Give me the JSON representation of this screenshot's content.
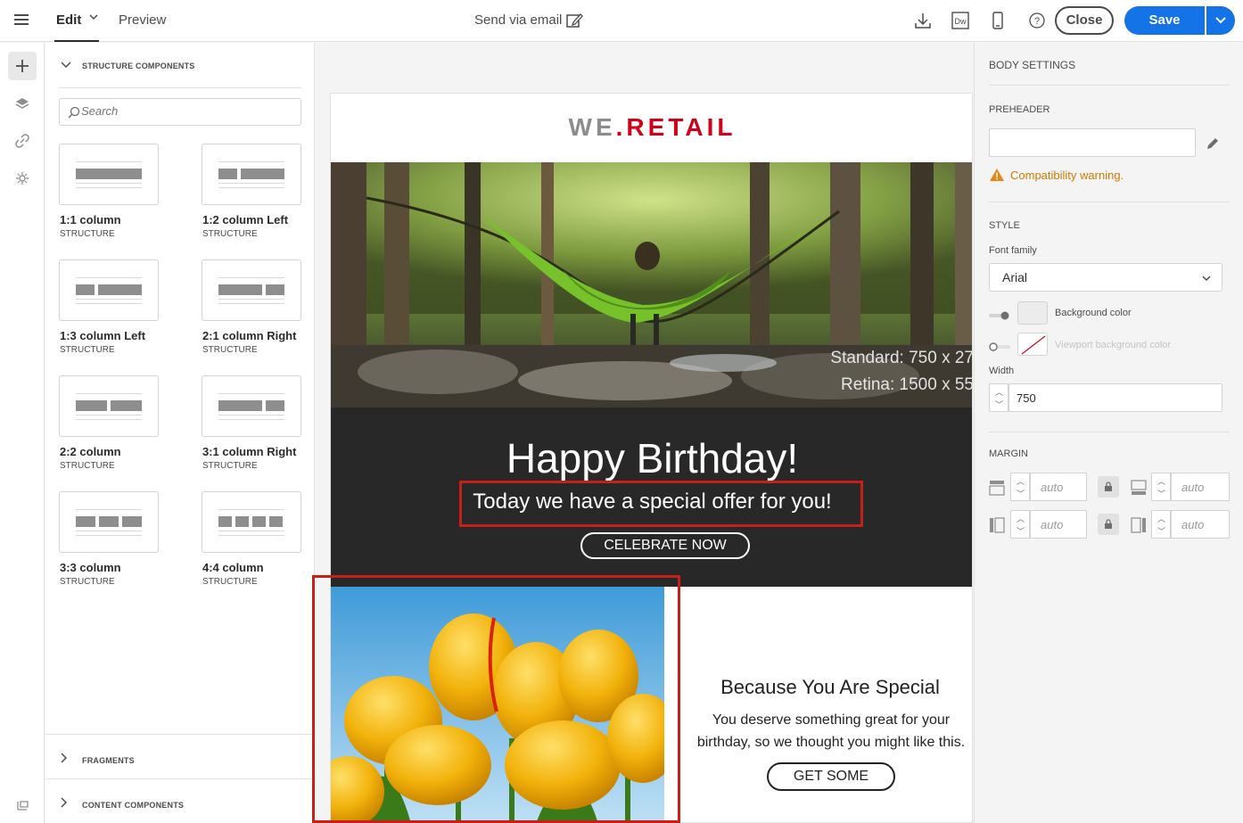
{
  "topbar": {
    "tab_edit": "Edit",
    "tab_preview": "Preview",
    "send_via_email": "Send via email",
    "close_label": "Close",
    "save_label": "Save",
    "dw_label": "Dw"
  },
  "panel": {
    "structure_heading": "STRUCTURE COMPONENTS",
    "search_placeholder": "Search",
    "components": [
      {
        "name": "1:1 column",
        "type": "STRUCTURE"
      },
      {
        "name": "1:2 column Left",
        "type": "STRUCTURE"
      },
      {
        "name": "1:3 column Left",
        "type": "STRUCTURE"
      },
      {
        "name": "2:1 column Right",
        "type": "STRUCTURE"
      },
      {
        "name": "2:2 column",
        "type": "STRUCTURE"
      },
      {
        "name": "3:1 column Right",
        "type": "STRUCTURE"
      },
      {
        "name": "3:3 column",
        "type": "STRUCTURE"
      },
      {
        "name": "4:4 column",
        "type": "STRUCTURE"
      }
    ],
    "fragments_heading": "FRAGMENTS",
    "content_heading": "CONTENT COMPONENTS"
  },
  "email": {
    "logo_we": "WE",
    "logo_dot": ".",
    "logo_retail": "RETAIL",
    "hero_standard": "Standard: 750 x 27",
    "hero_retina": "Retina: 1500 x 55",
    "headline": "Happy Birthday!",
    "offer": "Today we have a special offer for you!",
    "cta_celebrate": "CELEBRATE NOW",
    "special_title": "Because You Are Special",
    "special_body": "You deserve something great for your birthday, so we thought you might like this.",
    "cta_get": "GET SOME"
  },
  "settings": {
    "title": "BODY SETTINGS",
    "preheader_label": "PREHEADER",
    "preheader_value": "",
    "warning": "Compatibility warning.",
    "style_label": "STYLE",
    "font_family_label": "Font family",
    "font_family_value": "Arial",
    "bg_color_label": "Background color",
    "viewport_bg_label": "Viewport background color",
    "width_label": "Width",
    "width_value": "750",
    "margin_label": "MARGIN",
    "margin_placeholder": "auto"
  },
  "colors": {
    "accent": "#1473e6",
    "brand_red": "#d0021b",
    "warning": "#d07a00",
    "highlight": "#c7201a"
  }
}
